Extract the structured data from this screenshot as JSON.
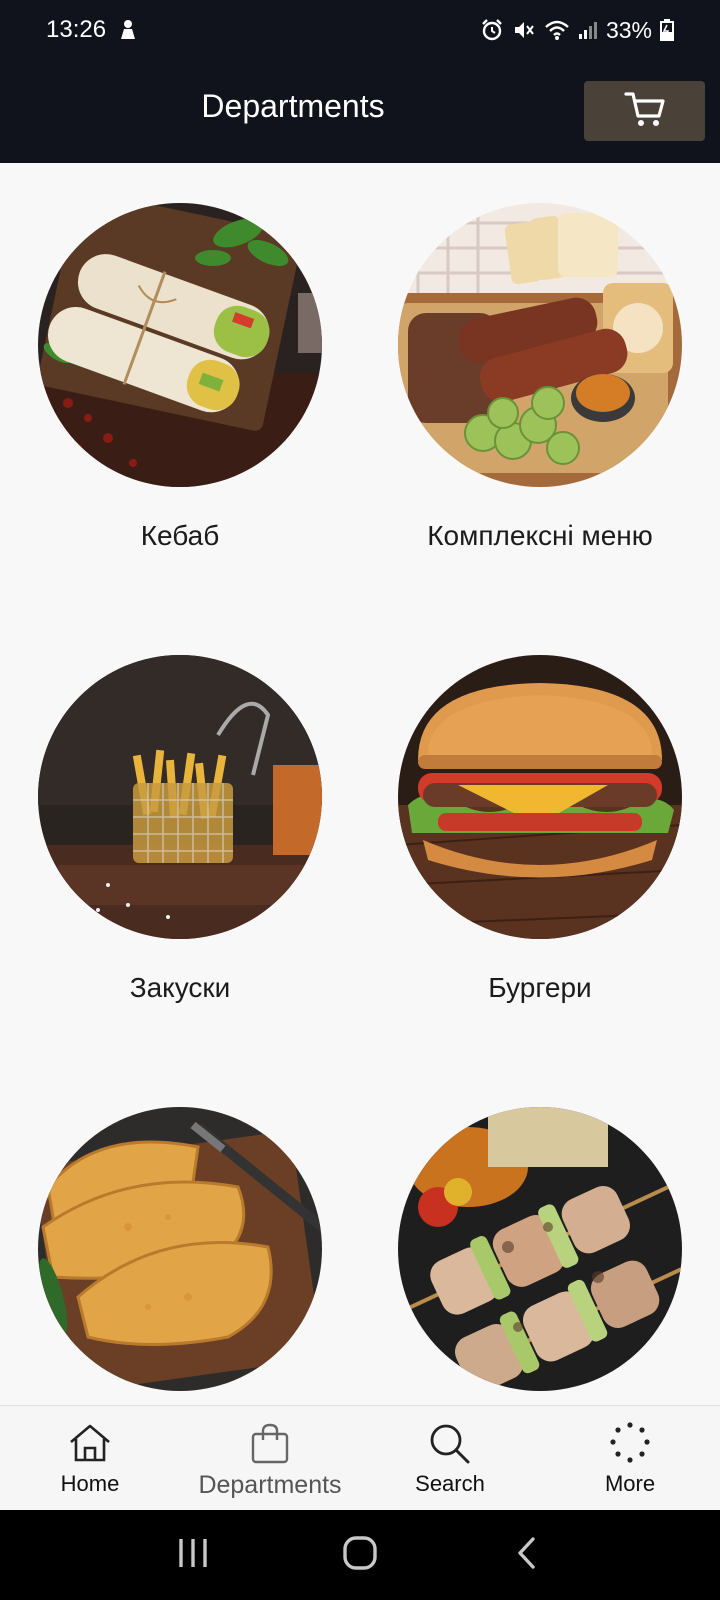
{
  "status_bar": {
    "time": "13:26",
    "battery_percent": "33%",
    "icons": [
      "person-notification-icon",
      "alarm-icon",
      "mute-icon",
      "wifi-icon",
      "signal-icon",
      "battery-icon"
    ]
  },
  "app_bar": {
    "title": "Departments",
    "cart_icon": "cart-icon"
  },
  "departments": [
    {
      "label": "Кебаб",
      "image": "kebab-wraps-photo"
    },
    {
      "label": "Комплексні меню",
      "image": "bbq-platter-photo"
    },
    {
      "label": "Закуски",
      "image": "fries-basket-photo"
    },
    {
      "label": "Бургери",
      "image": "burger-photo"
    },
    {
      "label": "",
      "image": "chebureki-photo"
    },
    {
      "label": "",
      "image": "shashlik-skewers-photo"
    }
  ],
  "bottom_nav": {
    "items": [
      {
        "label": "Home",
        "icon": "home-icon",
        "active": false
      },
      {
        "label": "Departments",
        "icon": "shopping-bag-icon",
        "active": true
      },
      {
        "label": "Search",
        "icon": "search-icon",
        "active": false
      },
      {
        "label": "More",
        "icon": "more-dots-icon",
        "active": false
      }
    ]
  },
  "system_nav": {
    "icons": [
      "recent-apps-icon",
      "home-circle-icon",
      "back-icon"
    ]
  },
  "colors": {
    "bar_background": "#10131b",
    "cart_button": "#4a4139",
    "page_background": "#f8f8f9"
  }
}
